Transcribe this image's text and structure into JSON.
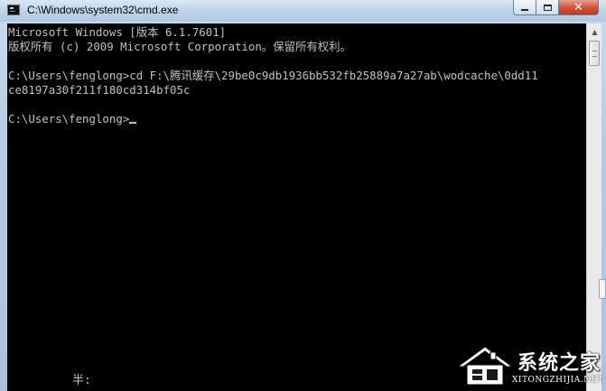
{
  "window": {
    "title": "C:\\Windows\\system32\\cmd.exe",
    "minimize_label": "",
    "maximize_label": "",
    "close_label": "✕"
  },
  "console": {
    "lines": [
      "Microsoft Windows [版本 6.1.7601]",
      "版权所有 (c) 2009 Microsoft Corporation。保留所有权利。",
      "",
      "C:\\Users\\fenglong>cd F:\\腾讯缓存\\29be0c9db1936bb532fb25889a7a27ab\\wodcache\\0dd11",
      "ce8197a30f211f180cd314bf05c",
      "",
      "C:\\Users\\fenglong>"
    ],
    "ime_status": "半:"
  },
  "watermark": {
    "name": "系统之家",
    "url": "XITONGZHIJIA.NET",
    "colors": {
      "text": "#ffffff",
      "shadow": "#000000"
    }
  },
  "colors": {
    "console_bg": "#000000",
    "console_text": "#c0c0c0",
    "close_button": "#c8432a",
    "frame": "#b3cbe4"
  }
}
